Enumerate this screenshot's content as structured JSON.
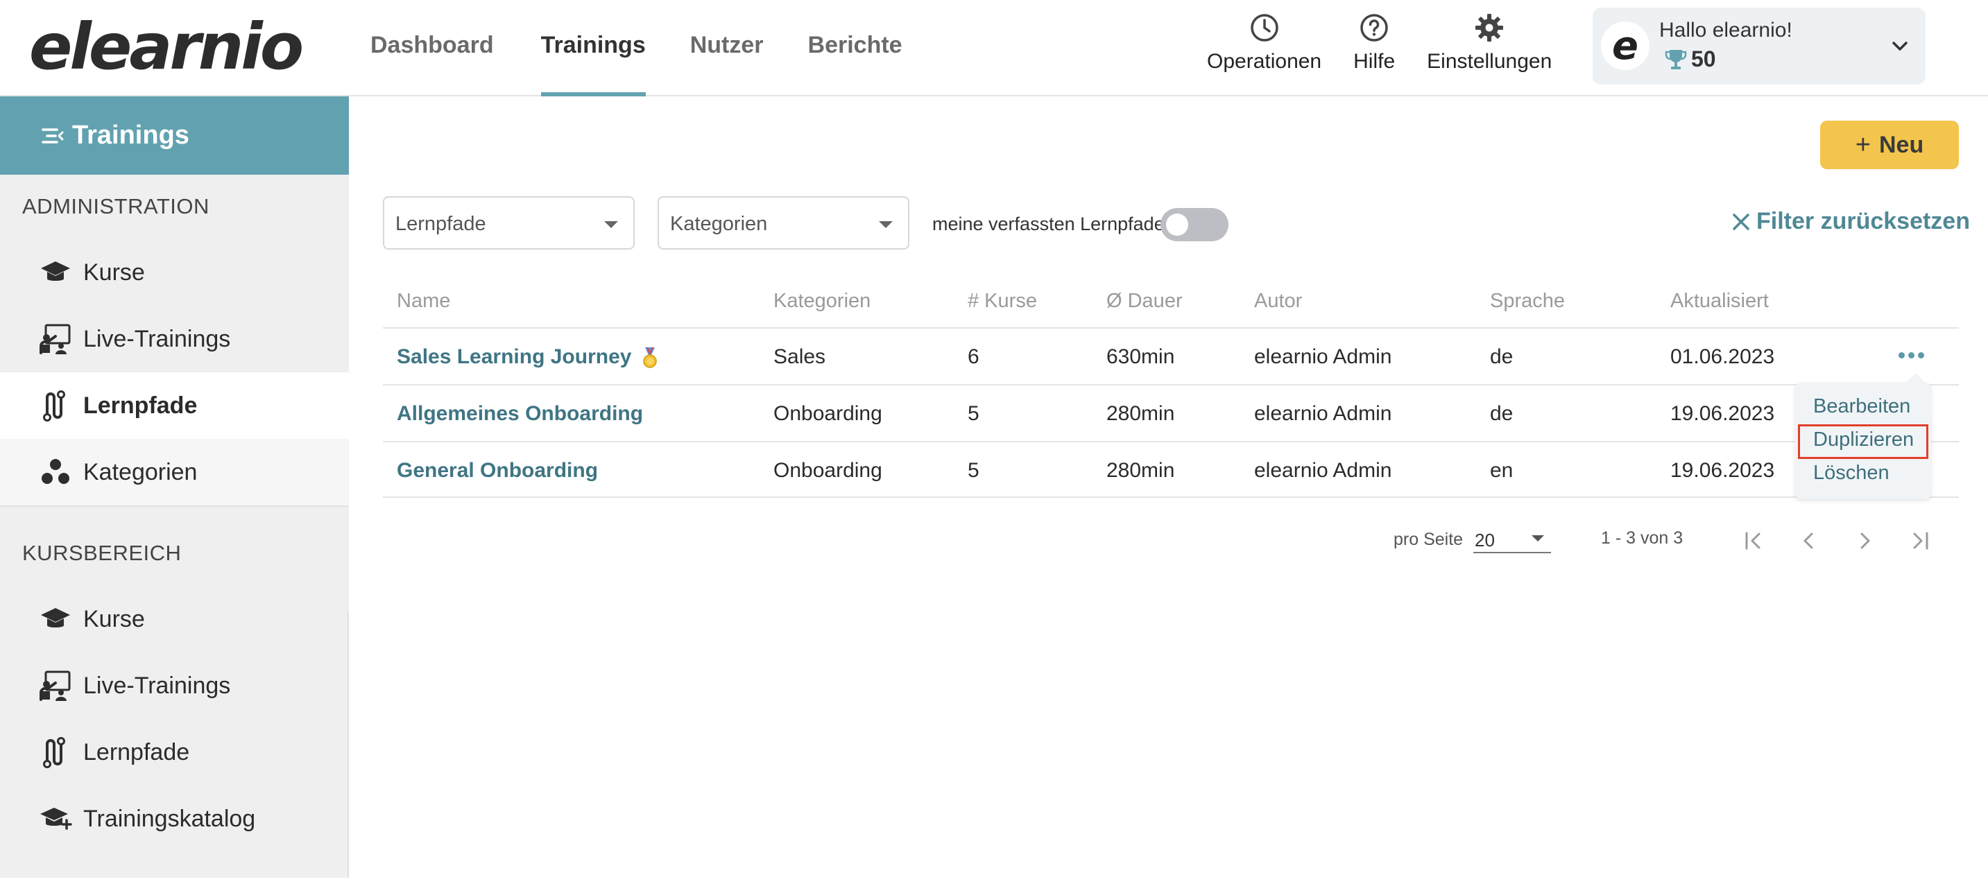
{
  "app": {
    "logo": "elearnio"
  },
  "nav": {
    "items": [
      {
        "label": "Dashboard",
        "active": false
      },
      {
        "label": "Trainings",
        "active": true
      },
      {
        "label": "Nutzer",
        "active": false
      },
      {
        "label": "Berichte",
        "active": false
      }
    ]
  },
  "top_actions": {
    "operations": {
      "label": "Operationen",
      "icon": "clock-icon"
    },
    "help": {
      "label": "Hilfe",
      "icon": "question-icon"
    },
    "settings": {
      "label": "Einstellungen",
      "icon": "gear-icon"
    }
  },
  "user": {
    "avatar_letter": "e",
    "greeting": "Hallo elearnio!",
    "points": "50"
  },
  "sidebar": {
    "header": "Trainings",
    "sections": [
      {
        "title": "ADMINISTRATION",
        "items": [
          {
            "label": "Kurse",
            "icon": "graduation-cap-icon",
            "active": false
          },
          {
            "label": "Live-Trainings",
            "icon": "presenter-icon",
            "active": false
          },
          {
            "label": "Lernpfade",
            "icon": "path-icon",
            "active": true
          },
          {
            "label": "Kategorien",
            "icon": "categories-icon",
            "active": false
          }
        ]
      },
      {
        "title": "KURSBEREICH",
        "items": [
          {
            "label": "Kurse",
            "icon": "graduation-cap-icon",
            "active": false
          },
          {
            "label": "Live-Trainings",
            "icon": "presenter-icon",
            "active": false
          },
          {
            "label": "Lernpfade",
            "icon": "path-icon",
            "active": false
          },
          {
            "label": "Trainingskatalog",
            "icon": "catalog-icon",
            "active": false
          }
        ]
      }
    ]
  },
  "toolbar": {
    "new_label": "Neu",
    "new_plus": "+"
  },
  "filters": {
    "learning_paths_placeholder": "Lernpfade",
    "categories_placeholder": "Kategorien",
    "toggle_label": "meine verfassten Lernpfade",
    "toggle_on": false,
    "reset_label": "Filter zurücksetzen"
  },
  "table": {
    "headers": [
      "Name",
      "Kategorien",
      "# Kurse",
      "Ø Dauer",
      "Autor",
      "Sprache",
      "Aktualisiert"
    ],
    "rows": [
      {
        "name": "Sales Learning Journey",
        "category": "Sales",
        "courses": "6",
        "duration": "630min",
        "author": "elearnio Admin",
        "language": "de",
        "updated": "01.06.2023",
        "badge": "medal-icon"
      },
      {
        "name": "Allgemeines Onboarding",
        "category": "Onboarding",
        "courses": "5",
        "duration": "280min",
        "author": "elearnio Admin",
        "language": "de",
        "updated": "19.06.2023"
      },
      {
        "name": "General Onboarding",
        "category": "Onboarding",
        "courses": "5",
        "duration": "280min",
        "author": "elearnio Admin",
        "language": "en",
        "updated": "19.06.2023"
      }
    ]
  },
  "row_menu": {
    "items": [
      "Bearbeiten",
      "Duplizieren",
      "Löschen"
    ],
    "highlighted": "Duplizieren"
  },
  "pagination": {
    "per_page_label": "pro Seite",
    "per_page_value": "20",
    "range": "1 - 3 von 3"
  },
  "colors": {
    "accent": "#62a2b0",
    "link": "#3f7584",
    "new_button": "#f4c54d",
    "highlight_border": "#e0402a"
  }
}
